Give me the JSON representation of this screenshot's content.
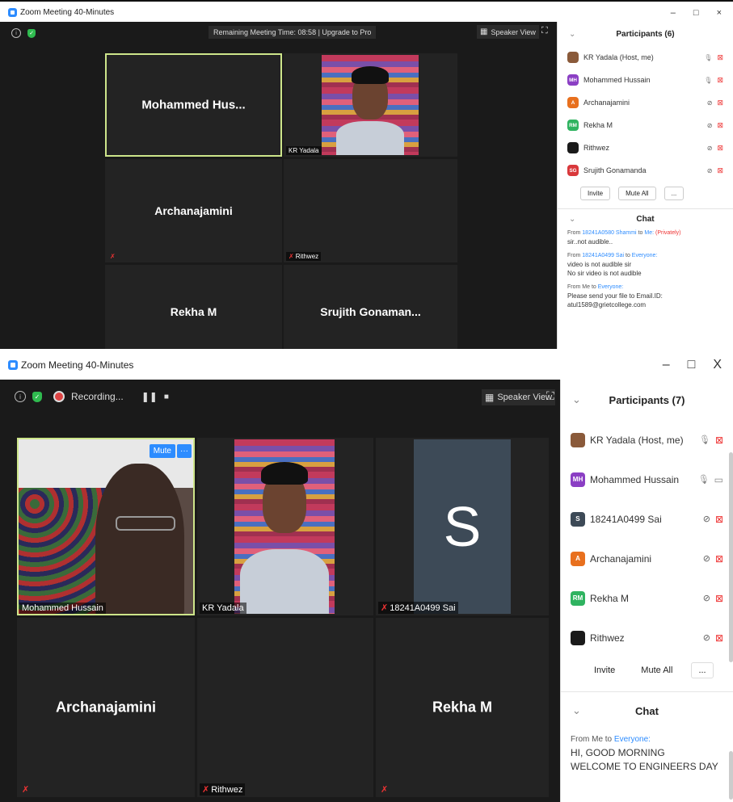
{
  "top": {
    "title": "Zoom Meeting 40-Minutes",
    "win_minimize": "–",
    "win_maximize": "□",
    "win_close": "×",
    "remaining": "Remaining Meeting Time: 08:58 | Upgrade to Pro",
    "speaker_view": "Speaker View",
    "tiles": {
      "mohammed": "Mohammed  Hus...",
      "kr_label": "KR Yadala",
      "archana": "Archanajamini",
      "rithwez": "Rithwez",
      "rekha": "Rekha M",
      "srujith": "Srujith  Gonaman..."
    },
    "participants": {
      "title": "Participants (6)",
      "items": [
        {
          "name": "KR Yadala (Host, me)",
          "initials": "",
          "color": "#8a5a3a"
        },
        {
          "name": "Mohammed Hussain",
          "initials": "MH",
          "color": "#8b3fc4"
        },
        {
          "name": "Archanajamini",
          "initials": "A",
          "color": "#e8701e"
        },
        {
          "name": "Rekha M",
          "initials": "RM",
          "color": "#2fb360"
        },
        {
          "name": "Rithwez",
          "initials": "",
          "color": "#1a1a1a"
        },
        {
          "name": "Srujith Gonamanda",
          "initials": "SG",
          "color": "#d9383b"
        }
      ],
      "invite": "Invite",
      "mute_all": "Mute All",
      "more": "..."
    },
    "chat": {
      "title": "Chat",
      "messages": [
        {
          "from": "From",
          "sender": "18241A0580 Shammi",
          "to_word": "to",
          "to": "Me:",
          "priv": "(Privately)",
          "lines": [
            "sir..not audible.."
          ]
        },
        {
          "from": "From",
          "sender": "18241A0499 Sai",
          "to_word": "to",
          "to": "Everyone:",
          "priv": "",
          "lines": [
            "video is not audible sir",
            "No sir video is not audible"
          ]
        },
        {
          "from": "From Me to",
          "sender": "",
          "to_word": "",
          "to": "Everyone:",
          "priv": "",
          "lines": [
            "Please send your file to Email.ID:",
            "atul1589@grietcollege.com"
          ]
        }
      ]
    }
  },
  "bottom": {
    "title": "Zoom Meeting 40-Minutes",
    "win_minimize": "–",
    "win_maximize": "□",
    "win_close": "X",
    "recording": "Recording...",
    "speaker_view": "Speaker View",
    "mute_btn": "Mute",
    "more_btn": "···",
    "tiles": {
      "mohammed_label": "Mohammed Hussain",
      "kr_label": "KR Yadala",
      "sai_letter": "S",
      "sai_label": "18241A0499 Sai",
      "archana": "Archanajamini",
      "rithwez_label": "Rithwez",
      "rekha": "Rekha M"
    },
    "participants": {
      "title": "Participants (7)",
      "items": [
        {
          "name": "KR Yadala (Host, me)",
          "initials": "",
          "color": "#8a5a3a"
        },
        {
          "name": "Mohammed Hussain",
          "initials": "MH",
          "color": "#8b3fc4"
        },
        {
          "name": "18241A0499 Sai",
          "initials": "S",
          "color": "#3d4a57"
        },
        {
          "name": "Archanajamini",
          "initials": "A",
          "color": "#e8701e"
        },
        {
          "name": "Rekha M",
          "initials": "RM",
          "color": "#2fb360"
        },
        {
          "name": "Rithwez",
          "initials": "",
          "color": "#1a1a1a"
        }
      ],
      "invite": "Invite",
      "mute_all": "Mute All",
      "more": "..."
    },
    "chat": {
      "title": "Chat",
      "from": "From Me to",
      "to": "Everyone:",
      "lines": [
        "HI, GOOD MORNING",
        "WELCOME  TO ENGINEERS DAY"
      ]
    }
  }
}
